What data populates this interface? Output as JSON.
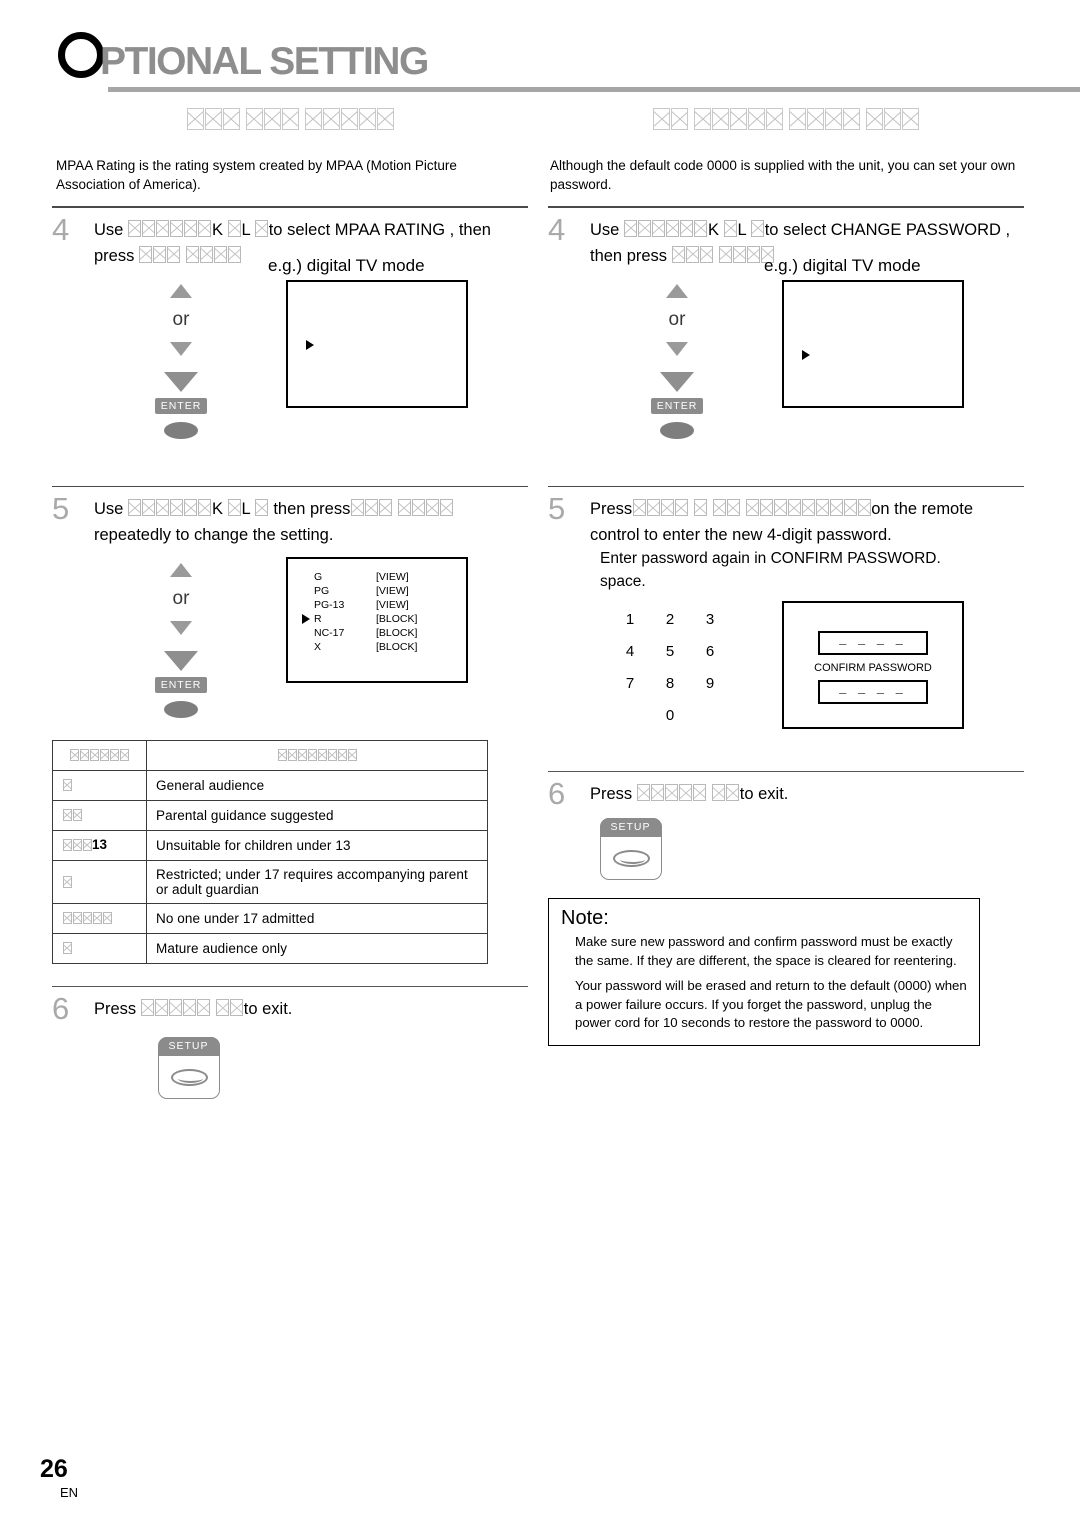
{
  "header": {
    "dropcap": "O",
    "title": "PTIONAL SETTING"
  },
  "left_column": {
    "section_heading_tofu": [
      3,
      3,
      5
    ],
    "intro": "MPAA Rating is the rating system created by MPAA (Motion Picture Association of America).",
    "step4": {
      "number": "4",
      "text_before": "Use",
      "text_mid_1": "K",
      "text_mid_2": "L",
      "text_after": "to select  MPAA RATING , then press",
      "eg_label": "e.g.) digital TV mode",
      "or_label": "or",
      "enter_label": "ENTER"
    },
    "step5": {
      "number": "5",
      "text_before": "Use",
      "text_mid_1": "K",
      "text_mid_2": "L",
      "text_mid_3": "then press",
      "text_after": "repeatedly to change the setting.",
      "or_label": "or",
      "enter_label": "ENTER"
    },
    "osd_ratings": {
      "cursor_on": "R",
      "rows": [
        {
          "code": "G",
          "status": "[VIEW]"
        },
        {
          "code": "PG",
          "status": "[VIEW]"
        },
        {
          "code": "PG-13",
          "status": "[VIEW]"
        },
        {
          "code": "R",
          "status": "[BLOCK]"
        },
        {
          "code": "NC-17",
          "status": "[BLOCK]"
        },
        {
          "code": "X",
          "status": "[BLOCK]"
        }
      ]
    },
    "rating_table": {
      "header_code_tofu": 6,
      "header_desc_tofu": 8,
      "rows": [
        {
          "code_tofu": 1,
          "desc": "General audience"
        },
        {
          "code_tofu": 2,
          "desc": "Parental guidance suggested"
        },
        {
          "code_tofu": 3,
          "code_suffix": "13",
          "desc": "Unsuitable for children under 13",
          "spaced": true
        },
        {
          "code_tofu": 1,
          "desc": "Restricted; under 17 requires accompanying parent or adult guardian"
        },
        {
          "code_tofu": 5,
          "desc": "No one under 17 admitted"
        },
        {
          "code_tofu": 1,
          "desc": "Mature audience only"
        }
      ]
    },
    "step6": {
      "number": "6",
      "text_before": "Press",
      "text_after": "to exit.",
      "setup_label": "SETUP"
    }
  },
  "right_column": {
    "section_heading_tofu": [
      2,
      5,
      4,
      3
    ],
    "intro": "Although the default code  0000  is supplied with the unit, you can set your own password.",
    "step4": {
      "number": "4",
      "text_before": "Use",
      "text_mid_1": "K",
      "text_mid_2": "L",
      "text_after": "to select  CHANGE PASSWORD , then press",
      "eg_label": "e.g.) digital TV mode",
      "or_label": "or",
      "enter_label": "ENTER"
    },
    "step5": {
      "number": "5",
      "text_before": "Press",
      "text_after": "on the remote control to enter the new 4-digit password.",
      "sub_line_1": "Enter password again in  CONFIRM PASSWORD.",
      "sub_line_2": "space.",
      "keypad": [
        "1",
        "2",
        "3",
        "4",
        "5",
        "6",
        "7",
        "8",
        "9",
        "0"
      ],
      "password_screen": {
        "field_1": "– – – –",
        "confirm_label": "CONFIRM PASSWORD",
        "field_2": "– – – –"
      }
    },
    "step6": {
      "number": "6",
      "text_before": "Press",
      "text_after": "to exit.",
      "setup_label": "SETUP"
    },
    "note": {
      "title": "Note:",
      "paragraph_1": "Make sure new password and confirm password must be exactly the same. If they are different, the space is cleared for reentering.",
      "paragraph_2": "Your password will be erased and return to the default (0000) when a power failure occurs. If you forget the password, unplug the power cord for 10 seconds to restore the password to 0000."
    }
  },
  "footer": {
    "page_number": "26",
    "language": "EN"
  }
}
